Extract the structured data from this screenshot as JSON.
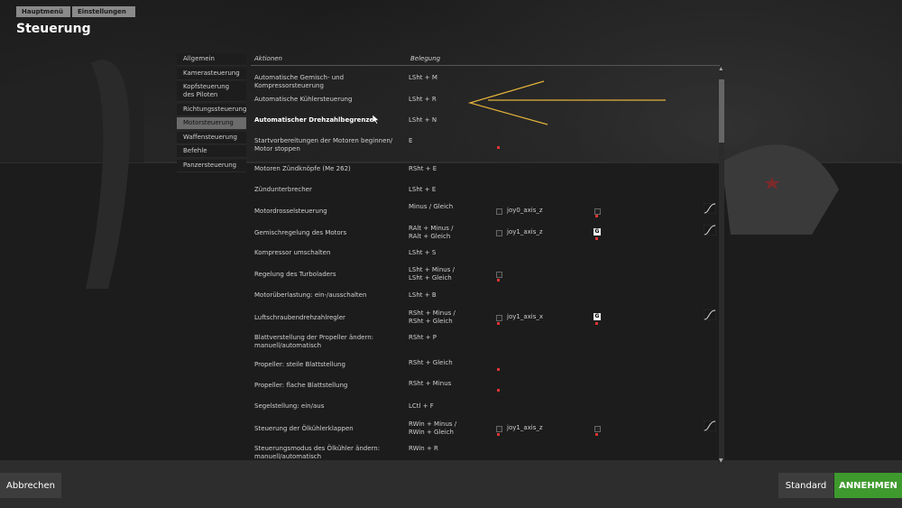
{
  "breadcrumb": [
    "Hauptmenü",
    "Einstellungen"
  ],
  "page_title": "Steuerung",
  "categories": [
    {
      "label": "Allgemein",
      "active": false
    },
    {
      "label": "Kamerasteuerung",
      "active": false
    },
    {
      "label": "Kopfsteuerung des Piloten",
      "active": false
    },
    {
      "label": "Richtungssteuerung",
      "active": false
    },
    {
      "label": "Motorsteuerung",
      "active": true
    },
    {
      "label": "Waffensteuerung",
      "active": false
    },
    {
      "label": "Befehle",
      "active": false
    },
    {
      "label": "Panzersteuerung",
      "active": false
    }
  ],
  "table_header": {
    "actions": "Aktionen",
    "binding": "Belegung"
  },
  "rows": [
    {
      "action": "Automatische Gemisch- und Kompressorsteuerung",
      "binding": "LSht + M"
    },
    {
      "action": "Automatische Kühlersteuerung",
      "binding": "LSht + R"
    },
    {
      "action": "Automatischer Drehzahlbegrenzer",
      "binding": "LSht + N",
      "bold": true
    },
    {
      "action": "Startvorbereitungen der Motoren beginnen/ Motor stoppen",
      "binding": "E"
    },
    {
      "action": "Motoren Zündknöpfe (Me 262)",
      "binding": "RSht + E"
    },
    {
      "action": "Zündunterbrecher",
      "binding": "LSht + E"
    },
    {
      "action": "Motordrosselsteuerung",
      "binding": "Minus / Gleich",
      "axis": "joy0_axis_z"
    },
    {
      "action": "Gemischregelung des Motors",
      "binding": "RAlt + Minus / RAlt + Gleich",
      "axis": "joy1_axis_z"
    },
    {
      "action": "Kompressor umschalten",
      "binding": "LSht + S"
    },
    {
      "action": "Regelung des Turboladers",
      "binding": "LSht + Minus / LSht + Gleich"
    },
    {
      "action": "Motorüberlastung: ein-/ausschalten",
      "binding": "LSht + B"
    },
    {
      "action": "Luftschraubendrehzahlregler",
      "binding": "RSht + Minus / RSht + Gleich",
      "axis": "joy1_axis_x"
    },
    {
      "action": "Blattverstellung der Propeller ändern: manuell/automatisch",
      "binding": "RSht + P"
    },
    {
      "action": "Propeller: steile Blattstellung",
      "binding": "RSht + Gleich"
    },
    {
      "action": "Propeller: flache Blattstellung",
      "binding": "RSht + Minus"
    },
    {
      "action": "Segelstellung: ein/aus",
      "binding": "LCtl + F"
    },
    {
      "action": "Steuerung der Ölkühlerklappen",
      "binding": "RWin + Minus / RWin + Gleich",
      "axis": "joy1_axis_z"
    },
    {
      "action": "Steuerungsmodus des Ölkühler ändern: manuell/automatisch",
      "binding": "RWin + R"
    }
  ],
  "buttons": {
    "cancel": "Abbrechen",
    "default": "Standard",
    "accept": "ANNEHMEN"
  },
  "colors": {
    "accent": "#3f9a2e",
    "annotation": "#e3b23a",
    "marker": "#d33333"
  }
}
